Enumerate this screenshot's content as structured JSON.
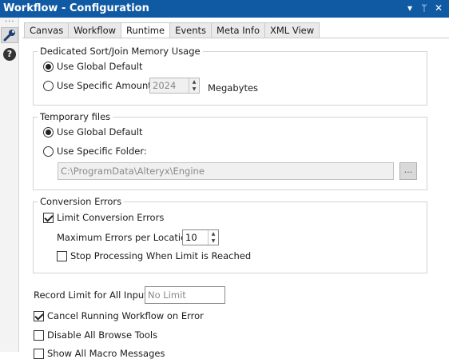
{
  "window": {
    "title": "Workflow - Configuration",
    "controls": {
      "dropdown": "▾",
      "pin": "ᛘ",
      "close": "✕"
    }
  },
  "sidebar": {
    "tool_icon": "wrench-icon",
    "help_icon": "help-icon",
    "help_glyph": "?"
  },
  "tabs": [
    {
      "label": "Canvas"
    },
    {
      "label": "Workflow"
    },
    {
      "label": "Runtime",
      "active": true
    },
    {
      "label": "Events"
    },
    {
      "label": "Meta Info"
    },
    {
      "label": "XML View"
    }
  ],
  "memory": {
    "title": "Dedicated Sort/Join Memory Usage",
    "global_label": "Use Global Default",
    "specific_label": "Use Specific Amount:",
    "amount_value": "2024",
    "unit": "Megabytes"
  },
  "temp_files": {
    "title": "Temporary files",
    "global_label": "Use Global Default",
    "specific_label": "Use Specific Folder:",
    "folder_value": "C:\\ProgramData\\Alteryx\\Engine",
    "browse_label": "..."
  },
  "conversion": {
    "title": "Conversion Errors",
    "limit_label": "Limit Conversion Errors",
    "max_label": "Maximum Errors per Location:",
    "max_value": "10",
    "stop_label": "Stop Processing When Limit is Reached"
  },
  "record_limit": {
    "label": "Record Limit for All Inputs:",
    "placeholder": "No Limit"
  },
  "options": {
    "cancel_on_error": "Cancel Running Workflow on Error",
    "disable_browse": "Disable All Browse Tools",
    "partial": "Show All Macro Messages"
  },
  "colors": {
    "titlebar": "#0f5aa3"
  }
}
